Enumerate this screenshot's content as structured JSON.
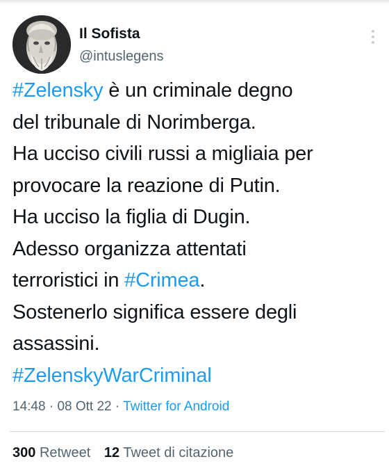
{
  "author": {
    "display_name": "Il Sofista",
    "handle": "@intuslegens",
    "avatar_icon": "philosopher-bust-icon"
  },
  "tweet": {
    "lines": [
      [
        {
          "text": "#Zelensky",
          "hashtag": true
        },
        {
          "text": " è un criminale degno",
          "hashtag": false
        }
      ],
      [
        {
          "text": "del tribunale di Norimberga.",
          "hashtag": false
        }
      ],
      [
        {
          "text": "Ha ucciso civili russi a migliaia per",
          "hashtag": false
        }
      ],
      [
        {
          "text": "provocare la reazione di Putin.",
          "hashtag": false
        }
      ],
      [
        {
          "text": "Ha ucciso la figlia di Dugin.",
          "hashtag": false
        }
      ],
      [
        {
          "text": "Adesso organizza attentati",
          "hashtag": false
        }
      ],
      [
        {
          "text": "terroristici in ",
          "hashtag": false
        },
        {
          "text": "#Crimea",
          "hashtag": true
        },
        {
          "text": ".",
          "hashtag": false
        }
      ],
      [
        {
          "text": "Sostenerlo significa essere degli",
          "hashtag": false
        }
      ],
      [
        {
          "text": "assassini.",
          "hashtag": false
        }
      ],
      [
        {
          "text": "#ZelenskyWarCriminal",
          "hashtag": true
        }
      ]
    ]
  },
  "meta": {
    "time": "14:48",
    "date": "08 Ott 22",
    "source": "Twitter for Android",
    "separator": " · "
  },
  "stats": {
    "retweets_count": "300",
    "retweets_label": "Retweet",
    "quotes_count": "12",
    "quotes_label": "Tweet di citazione"
  },
  "colors": {
    "hashtag": "#1d9bf0",
    "secondary_text": "#536471",
    "primary_text": "#0f1419"
  }
}
